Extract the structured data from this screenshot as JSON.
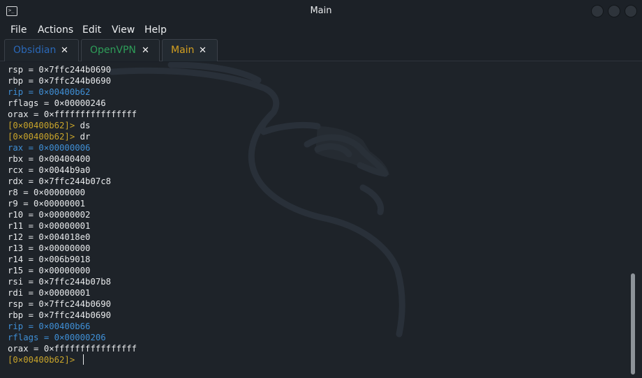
{
  "window": {
    "title": "Main"
  },
  "menu": [
    "File",
    "Actions",
    "Edit",
    "View",
    "Help"
  ],
  "tabs": [
    {
      "label": "Obsidian",
      "color": "#2a68b8",
      "active": false
    },
    {
      "label": "OpenVPN",
      "color": "#2e9e59",
      "active": false
    },
    {
      "label": "Main",
      "color": "#d4a020",
      "active": true
    }
  ],
  "tab_close_glyph": "✕",
  "terminal": {
    "lines": [
      {
        "text": "rsp = 0×7ffc244b0690",
        "color": "white"
      },
      {
        "text": "rbp = 0×7ffc244b0690",
        "color": "white"
      },
      {
        "text": "rip = 0×00400b62",
        "color": "blue"
      },
      {
        "text": "rflags = 0×00000246",
        "color": "white"
      },
      {
        "text": "orax = 0×ffffffffffffffff",
        "color": "white"
      },
      {
        "prompt": "[0×00400b62]>",
        "cmd": " ds"
      },
      {
        "prompt": "[0×00400b62]>",
        "cmd": " dr"
      },
      {
        "text": "rax = 0×00000006",
        "color": "blue"
      },
      {
        "text": "rbx = 0×00400400",
        "color": "white"
      },
      {
        "text": "rcx = 0×0044b9a0",
        "color": "white"
      },
      {
        "text": "rdx = 0×7ffc244b07c8",
        "color": "white"
      },
      {
        "text": "r8 = 0×00000000",
        "color": "white"
      },
      {
        "text": "r9 = 0×00000001",
        "color": "white"
      },
      {
        "text": "r10 = 0×00000002",
        "color": "white"
      },
      {
        "text": "r11 = 0×00000001",
        "color": "white"
      },
      {
        "text": "r12 = 0×004018e0",
        "color": "white"
      },
      {
        "text": "r13 = 0×00000000",
        "color": "white"
      },
      {
        "text": "r14 = 0×006b9018",
        "color": "white"
      },
      {
        "text": "r15 = 0×00000000",
        "color": "white"
      },
      {
        "text": "rsi = 0×7ffc244b07b8",
        "color": "white"
      },
      {
        "text": "rdi = 0×00000001",
        "color": "white"
      },
      {
        "text": "rsp = 0×7ffc244b0690",
        "color": "white"
      },
      {
        "text": "rbp = 0×7ffc244b0690",
        "color": "white"
      },
      {
        "text": "rip = 0×00400b66",
        "color": "blue"
      },
      {
        "text": "rflags = 0×00000206",
        "color": "blue"
      },
      {
        "text": "orax = 0×ffffffffffffffff",
        "color": "white"
      },
      {
        "prompt": "[0×00400b62]>",
        "cmd": " ",
        "cursor": true
      }
    ]
  }
}
